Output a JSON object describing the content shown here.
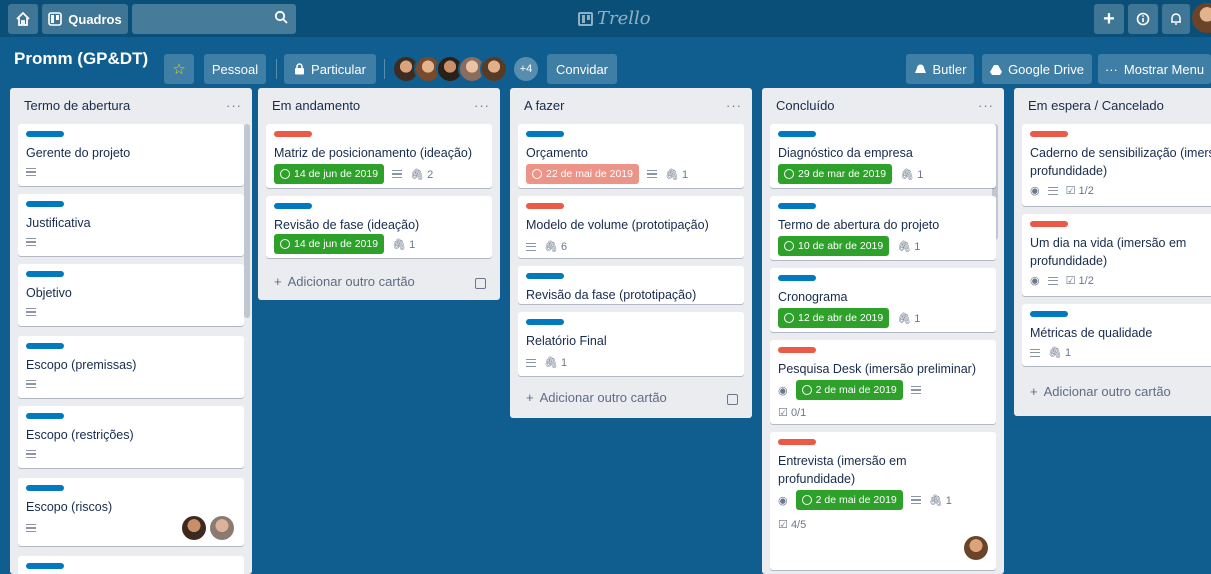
{
  "header": {
    "boards_label": "Quadros",
    "logo_text": "Trello",
    "home_icon": "home-icon",
    "search_icon": "search-icon"
  },
  "board": {
    "title": "Promm (GP&DT)",
    "team": "Pessoal",
    "visibility": "Particular",
    "extra_members": "+4",
    "invite": "Convidar",
    "butler": "Butler",
    "google_drive": "Google Drive",
    "menu": "Mostrar Menu"
  },
  "lists": [
    {
      "title": "Termo de abertura",
      "cards": [
        {
          "label": "blue",
          "title": "Gerente do projeto"
        },
        {
          "label": "blue",
          "title": "Justificativa"
        },
        {
          "label": "blue",
          "title": "Objetivo"
        },
        {
          "label": "blue",
          "title": "Escopo (premissas)"
        },
        {
          "label": "blue",
          "title": "Escopo (restrições)"
        },
        {
          "label": "blue",
          "title": "Escopo (riscos)"
        }
      ]
    },
    {
      "title": "Em andamento",
      "cards": [
        {
          "label": "red",
          "title": "Matriz de posicionamento (ideação)",
          "due": "14 de jun de 2019",
          "attachments": "2"
        },
        {
          "label": "blue",
          "title": "Revisão de fase (ideação)",
          "due": "14 de jun de 2019",
          "attachments": "1"
        }
      ],
      "add_card": "Adicionar outro cartão"
    },
    {
      "title": "A fazer",
      "cards": [
        {
          "label": "blue",
          "title": "Orçamento",
          "due": "22 de mai de 2019",
          "attachments": "1"
        },
        {
          "label": "red",
          "title": "Modelo de volume (prototipação)",
          "attachments": "6"
        },
        {
          "label": "blue",
          "title": "Revisão da fase (prototipação)"
        },
        {
          "label": "blue",
          "title": "Relatório Final",
          "attachments": "1"
        }
      ],
      "add_card": "Adicionar outro cartão"
    },
    {
      "title": "Concluído",
      "cards": [
        {
          "label": "blue",
          "title": "Diagnóstico da empresa",
          "due": "29 de mar de 2019",
          "attachments": "1"
        },
        {
          "label": "blue",
          "title": "Termo de abertura do projeto",
          "due": "10 de abr de 2019",
          "attachments": "1"
        },
        {
          "label": "blue",
          "title": "Cronograma",
          "due": "12 de abr de 2019",
          "attachments": "1"
        },
        {
          "label": "red",
          "title": "Pesquisa Desk (imersão preliminar)",
          "due": "2 de mai de 2019",
          "checklist": "0/1"
        },
        {
          "label": "red",
          "title_line1": "Entrevista (imersão em",
          "title_line2": "profundidade)",
          "due": "2 de mai de 2019",
          "attachments": "1",
          "checklist": "4/5"
        }
      ]
    },
    {
      "title": "Em espera / Cancelado",
      "cards": [
        {
          "label": "red",
          "title_line1": "Caderno de sensibilização (imersão",
          "title_line2": "profundidade)",
          "checklist": "1/2"
        },
        {
          "label": "red",
          "title_line1": "Um dia na vida (imersão em",
          "title_line2": "profundidade)",
          "checklist": "1/2"
        },
        {
          "label": "blue",
          "title": "Métricas de qualidade",
          "attachments": "1"
        }
      ],
      "add_card": "Adicionar outro cartão"
    }
  ],
  "list_menu": "···",
  "add_icon": "+",
  "clip_glyph": "🖇",
  "eye_glyph": "◉",
  "check_glyph": "☑"
}
